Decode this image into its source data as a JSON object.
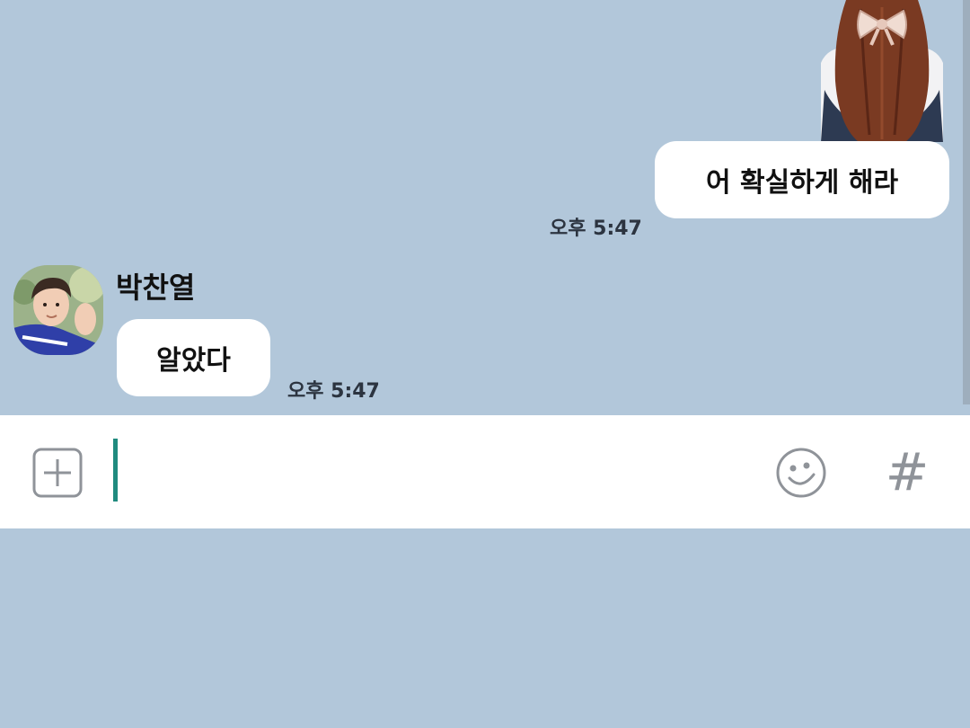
{
  "messages": {
    "outgoing": {
      "text": "어 확실하게 해라",
      "time": "오후 5:47"
    },
    "incoming": {
      "sender": "박찬열",
      "text": "알았다",
      "time": "오후 5:47"
    }
  },
  "input_bar": {
    "value": "",
    "hash_label": "#"
  },
  "colors": {
    "chat_background": "#b2c7da",
    "bubble": "#ffffff",
    "caret": "#1f8a7e",
    "icon_gray": "#8f9399"
  },
  "icons": {
    "attach": "plus-square-icon",
    "emoji": "smiley-icon",
    "hash": "hash-icon"
  }
}
